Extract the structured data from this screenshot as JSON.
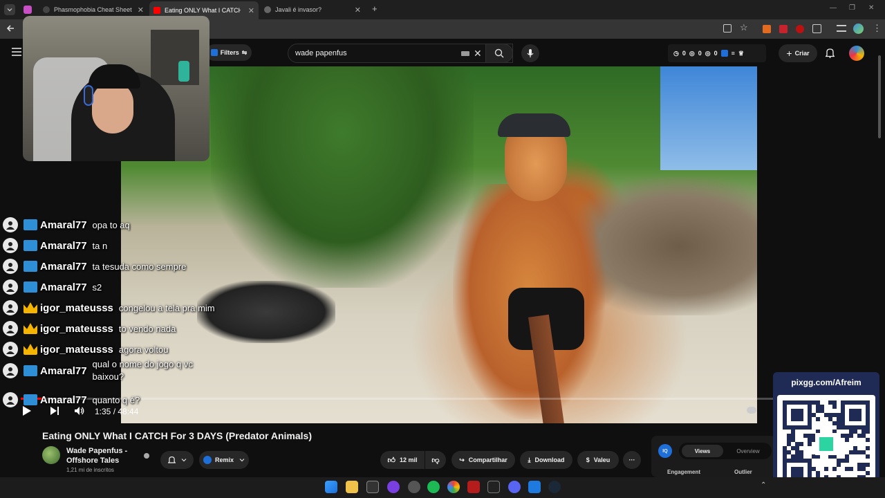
{
  "browser": {
    "tabs": [
      {
        "label": "Phasmophobia Cheat Sheet",
        "active": false
      },
      {
        "label": "Eating ONLY What I CATCH For",
        "active": true
      },
      {
        "label": "Javali é invasor?",
        "active": false
      }
    ],
    "new_tab": "+",
    "close": "✕"
  },
  "youtube": {
    "filters_label": "Filters",
    "search_value": "wade papenfus",
    "counters": [
      "0",
      "0",
      "0"
    ],
    "create_label": "Criar"
  },
  "player": {
    "time": "1:35 / 48:44",
    "progress_fraction": 0.0325
  },
  "chat": [
    {
      "user": "Amaral77",
      "badge": "blue",
      "message": "opa to aq"
    },
    {
      "user": "Amaral77",
      "badge": "blue",
      "message": "ta n"
    },
    {
      "user": "Amaral77",
      "badge": "blue",
      "message": "ta tesuda como sempre"
    },
    {
      "user": "Amaral77",
      "badge": "blue",
      "message": "s2"
    },
    {
      "user": "igor_mateusss",
      "badge": "crown",
      "message": "congelou a tela pra mim"
    },
    {
      "user": "igor_mateusss",
      "badge": "crown",
      "message": "to vendo nada"
    },
    {
      "user": "igor_mateusss",
      "badge": "crown",
      "message": "agora voltou"
    },
    {
      "user": "Amaral77",
      "badge": "blue",
      "message": "qual o nome do jogo q vc baixou?"
    },
    {
      "user": "Amaral77",
      "badge": "blue",
      "message": "quanto q é?"
    }
  ],
  "video": {
    "title": "Eating ONLY What I CATCH For 3 DAYS (Predator Animals)",
    "channel": "Wade Papenfus - Offshore Tales",
    "subscribers": "1,21 mi de inscritos",
    "remix_label": "Remix",
    "likes": "12 mil",
    "share_label": "Compartilhar",
    "download_label": "Download",
    "thanks_label": "Valeu",
    "more_label": "···"
  },
  "stats_panel": {
    "tabs": [
      "Views",
      "Overview"
    ],
    "labels": [
      "Engagement",
      "Outlier"
    ],
    "logo": "IQ"
  },
  "overlay": {
    "qr_url": "pixgg.com/Afreim"
  },
  "colors": {
    "accent_red": "#ff0000",
    "crown_gold": "#f5b400",
    "blue_badge": "#2f8fd6",
    "qr_bg": "#1f2b55"
  }
}
